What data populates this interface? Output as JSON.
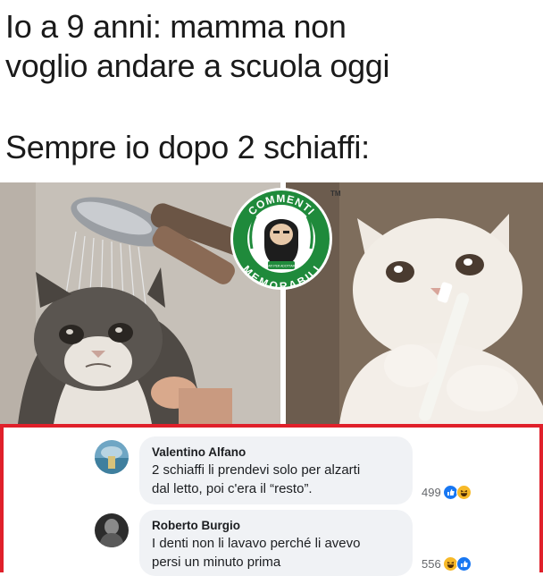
{
  "meme": {
    "line1": "Io a 9 anni: mamma non",
    "line2": "voglio andare a scuola oggi",
    "line3": "Sempre io dopo 2 schiaffi:"
  },
  "logo": {
    "top_text": "COMMENTI",
    "bottom_text": "MEMORABILI",
    "small_text": "MATI PER ADOTTARE",
    "tm": "TM",
    "color": "#1f8a3b"
  },
  "comments": [
    {
      "author": "Valentino Alfano",
      "text_line1": "2 schiaffi li prendevi solo per alzarti",
      "text_line2": "dal letto, poi c'era il “resto”.",
      "reaction_count": "499",
      "reaction_icons": [
        "like-icon",
        "laugh-icon"
      ]
    },
    {
      "author": "Roberto Burgio",
      "text_line1": "I denti non li lavavo perché li avevo",
      "text_line2": "persi un minuto prima",
      "reaction_count": "556",
      "reaction_icons": [
        "laugh-icon",
        "like-icon"
      ]
    }
  ],
  "colors": {
    "highlight_border": "#e0202a",
    "bubble_bg": "#f0f2f5",
    "like_blue": "#1877f2",
    "laugh_yellow": "#f7b928"
  }
}
